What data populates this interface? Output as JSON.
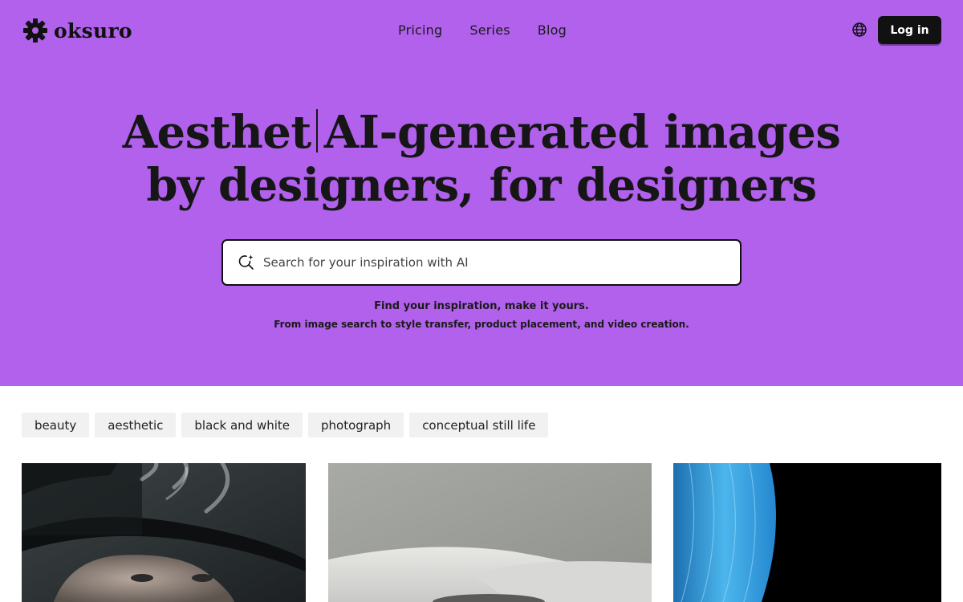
{
  "brand": {
    "name": "oksuro",
    "logo_icon": "gear-icon"
  },
  "nav": {
    "links": [
      "Pricing",
      "Series",
      "Blog"
    ]
  },
  "header": {
    "language_icon": "globe-icon",
    "login_label": "Log in"
  },
  "hero": {
    "typed_word": "Aesthet",
    "headline_line1_rest": "AI-generated images",
    "headline_line2": "by designers, for designers",
    "background_color": "#b161ec"
  },
  "search": {
    "placeholder": "Search for your inspiration with AI",
    "icon": "ai-search-icon"
  },
  "subtitle": {
    "line1": "Find your inspiration, make it yours.",
    "line2": "From image search to style transfer, product placement, and video creation."
  },
  "tags": [
    "beauty",
    "aesthetic",
    "black and white",
    "photograph",
    "conceptual still life"
  ],
  "gallery": [
    {
      "subject": "portrait-with-hat-and-smoke"
    },
    {
      "subject": "white-ceramic-surface"
    },
    {
      "subject": "blue-hair-on-black"
    }
  ]
}
